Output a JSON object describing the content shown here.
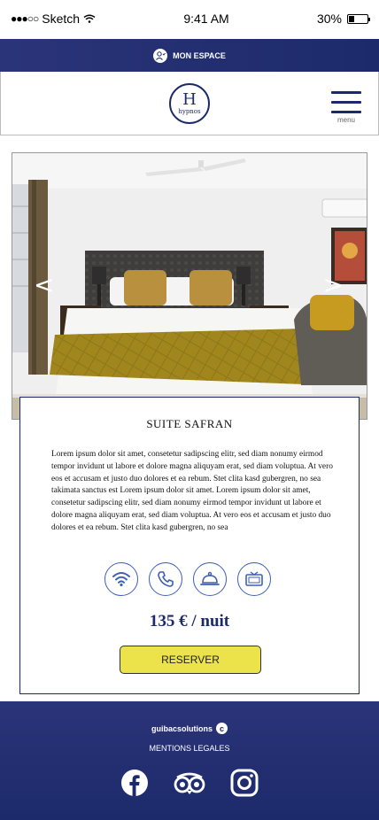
{
  "status_bar": {
    "carrier": "Sketch",
    "time": "9:41 AM",
    "battery": "30%",
    "battery_level": 0.3
  },
  "topbar": {
    "label": "MON ESPACE"
  },
  "header": {
    "logo_letter": "H",
    "logo_text": "hypnos",
    "menu_label": "menu"
  },
  "gallery": {
    "prev_icon": "chevron-left-icon",
    "next_icon": "chevron-right-icon"
  },
  "room": {
    "title": "SUITE SAFRAN",
    "description": "Lorem ipsum dolor sit amet, consetetur sadipscing elitr, sed diam nonumy eirmod tempor invidunt ut labore et dolore magna aliquyam erat, sed diam voluptua. At vero eos et accusam et justo duo dolores et ea rebum. Stet clita kasd gubergren, no sea takimata sanctus est Lorem ipsum dolor sit amet. Lorem ipsum dolor sit amet, consetetur sadipscing elitr, sed diam nonumy eirmod tempor invidunt ut labore et dolore magna aliquyam erat, sed diam voluptua. At vero eos et accusam et justo duo dolores et ea rebum. Stet clita kasd gubergren, no sea",
    "amenities": [
      "wifi-icon",
      "phone-icon",
      "room-service-bell-icon",
      "tv-icon"
    ],
    "price": "135 € / nuit",
    "reserve_label": "RESERVER"
  },
  "footer": {
    "brand": "guibacsolutions",
    "brand_mark": "c",
    "legal": "MENTIONS LEGALES",
    "socials": [
      "facebook-icon",
      "tripadvisor-icon",
      "instagram-icon"
    ]
  },
  "colors": {
    "navy": "#1c2a6b",
    "accent_blue": "#3e5fb3",
    "button_yellow": "#ece34a"
  }
}
